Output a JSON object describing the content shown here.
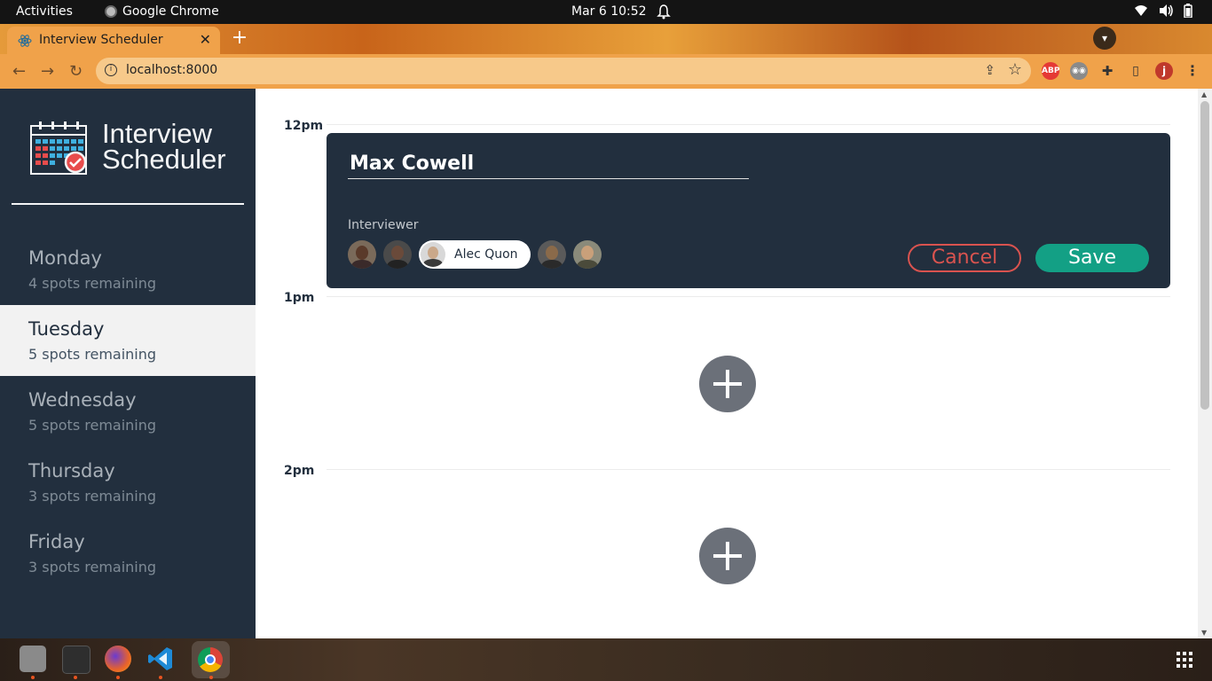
{
  "system": {
    "activities": "Activities",
    "app_name": "Google Chrome",
    "clock": "Mar 6  10:52"
  },
  "browser": {
    "tab_title": "Interview Scheduler",
    "url": "localhost:8000",
    "extensions": [
      "ABP"
    ],
    "profile_initial": "j"
  },
  "app": {
    "logo_title_line1": "Interview",
    "logo_title_line2": "Scheduler",
    "days": [
      {
        "name": "Monday",
        "spots": "4 spots remaining"
      },
      {
        "name": "Tuesday",
        "spots": "5 spots remaining"
      },
      {
        "name": "Wednesday",
        "spots": "5 spots remaining"
      },
      {
        "name": "Thursday",
        "spots": "3 spots remaining"
      },
      {
        "name": "Friday",
        "spots": "3 spots remaining"
      }
    ],
    "selected_day": "Tuesday",
    "times": [
      "12pm",
      "1pm",
      "2pm"
    ],
    "form": {
      "student_name": "Max Cowell",
      "interviewer_label": "Interviewer",
      "selected_interviewer": "Alec Quon",
      "cancel_label": "Cancel",
      "save_label": "Save"
    }
  },
  "colors": {
    "sidebar_bg": "#222f3e",
    "save_green": "#13a085",
    "cancel_red": "#d9534f",
    "add_button_gray": "#6b7079"
  }
}
